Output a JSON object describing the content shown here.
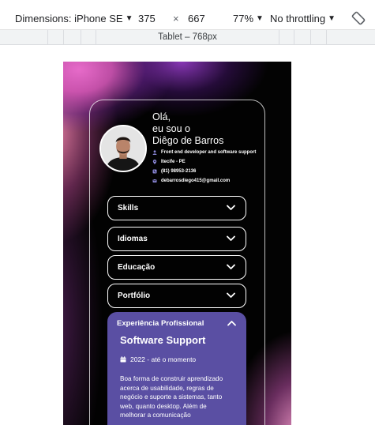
{
  "toolbar": {
    "dimensions_label": "Dimensions: iPhone SE",
    "width": "375",
    "times": "×",
    "height": "667",
    "zoom": "77%",
    "throttling": "No throttling"
  },
  "media_query": {
    "label": "Tablet – 768px"
  },
  "profile": {
    "greeting_line1": "Olá,",
    "greeting_line2": "eu sou o",
    "name": "Diêgo de Barros",
    "info": [
      {
        "icon": "user-icon",
        "text": "Front end developer and software support"
      },
      {
        "icon": "location-pin-icon",
        "text": "Itecife - PE"
      },
      {
        "icon": "phone-icon",
        "text": "(81) 98953-2136"
      },
      {
        "icon": "email-icon",
        "text": "debarrosdiego415@gmail.com"
      }
    ]
  },
  "sections": [
    {
      "label": "Skills"
    },
    {
      "label": "Idiomas"
    },
    {
      "label": "Educação"
    },
    {
      "label": "Portfólio"
    }
  ],
  "experience": {
    "label": "Experiência Profissional",
    "job_title": "Software Support",
    "period": "2022 - até o momento",
    "description": "Boa forma de construir aprendizado acerca de usabilidade, regras de negócio e suporte a sistemas, tanto web, quanto desktop. Além de melhorar a comunicação"
  },
  "colors": {
    "accent_panel": "#5a4fa3",
    "background": "#030303"
  }
}
